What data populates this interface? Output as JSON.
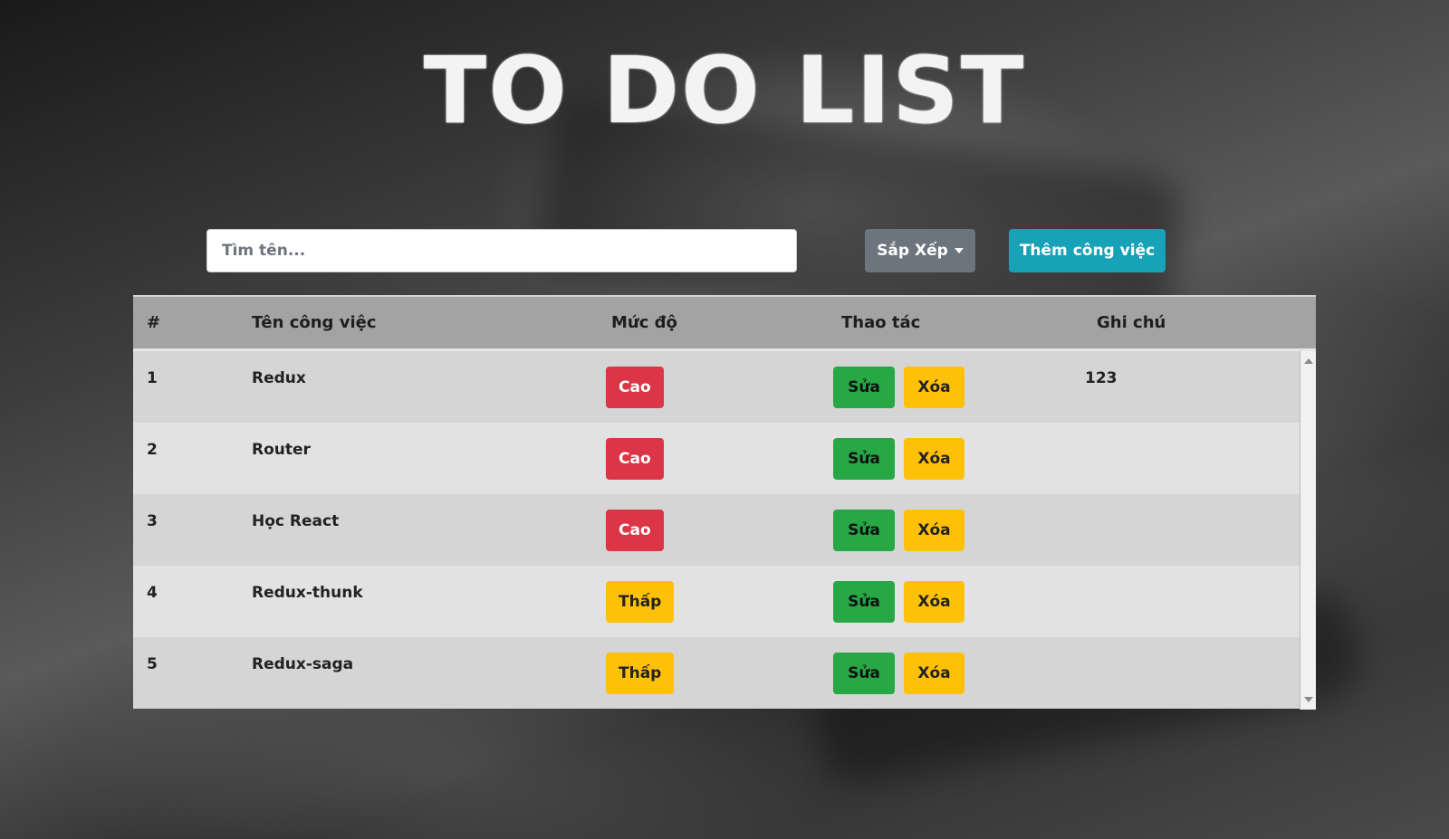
{
  "app": {
    "title": "TO DO LIST"
  },
  "search": {
    "placeholder": "Tìm tên...",
    "value": ""
  },
  "toolbar": {
    "sort_label": "Sắp Xếp",
    "add_label": "Thêm công việc"
  },
  "table": {
    "headers": {
      "index": "#",
      "name": "Tên công việc",
      "level": "Mức độ",
      "actions": "Thao tác",
      "note": "Ghi chú"
    },
    "edit_label": "Sửa",
    "delete_label": "Xóa",
    "rows": [
      {
        "index": "1",
        "name": "Redux",
        "level": "Cao",
        "level_type": "high",
        "note": "123"
      },
      {
        "index": "2",
        "name": "Router",
        "level": "Cao",
        "level_type": "high",
        "note": ""
      },
      {
        "index": "3",
        "name": "Học React",
        "level": "Cao",
        "level_type": "high",
        "note": ""
      },
      {
        "index": "4",
        "name": "Redux-thunk",
        "level": "Thấp",
        "level_type": "low",
        "note": ""
      },
      {
        "index": "5",
        "name": "Redux-saga",
        "level": "Thấp",
        "level_type": "low",
        "note": ""
      }
    ]
  },
  "colors": {
    "high_badge": "#dc3545",
    "low_badge": "#ffc107",
    "edit_button": "#28a745",
    "delete_button": "#ffc107",
    "sort_button": "#6c757d",
    "add_button": "#17a2b8"
  }
}
